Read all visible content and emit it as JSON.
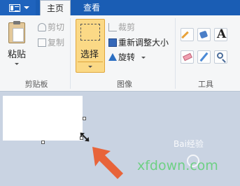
{
  "tabs": {
    "home": "主页",
    "view": "查看"
  },
  "app_menu_icon": "app-menu-icon",
  "clipboard": {
    "paste": "粘贴",
    "cut": "剪切",
    "copy": "复制",
    "group": "剪贴板"
  },
  "image": {
    "select": "选择",
    "crop": "裁剪",
    "resize": "重新调整大小",
    "rotate": "旋转",
    "group": "图像"
  },
  "tools": {
    "group": "工具",
    "text_tool": "A",
    "icons": [
      "pencil-icon",
      "fill-icon",
      "text-icon",
      "eraser-icon",
      "color-picker-icon",
      "magnifier-icon"
    ]
  },
  "watermark": {
    "site": "xfdown.com",
    "baidu": "Bai经验"
  },
  "colors": {
    "tab_bar": "#1a5db4",
    "select_active": "#fbd986",
    "canvas_bg": "#c9d3e2",
    "arrow": "#e8643a",
    "watermark": "#6ed084"
  }
}
